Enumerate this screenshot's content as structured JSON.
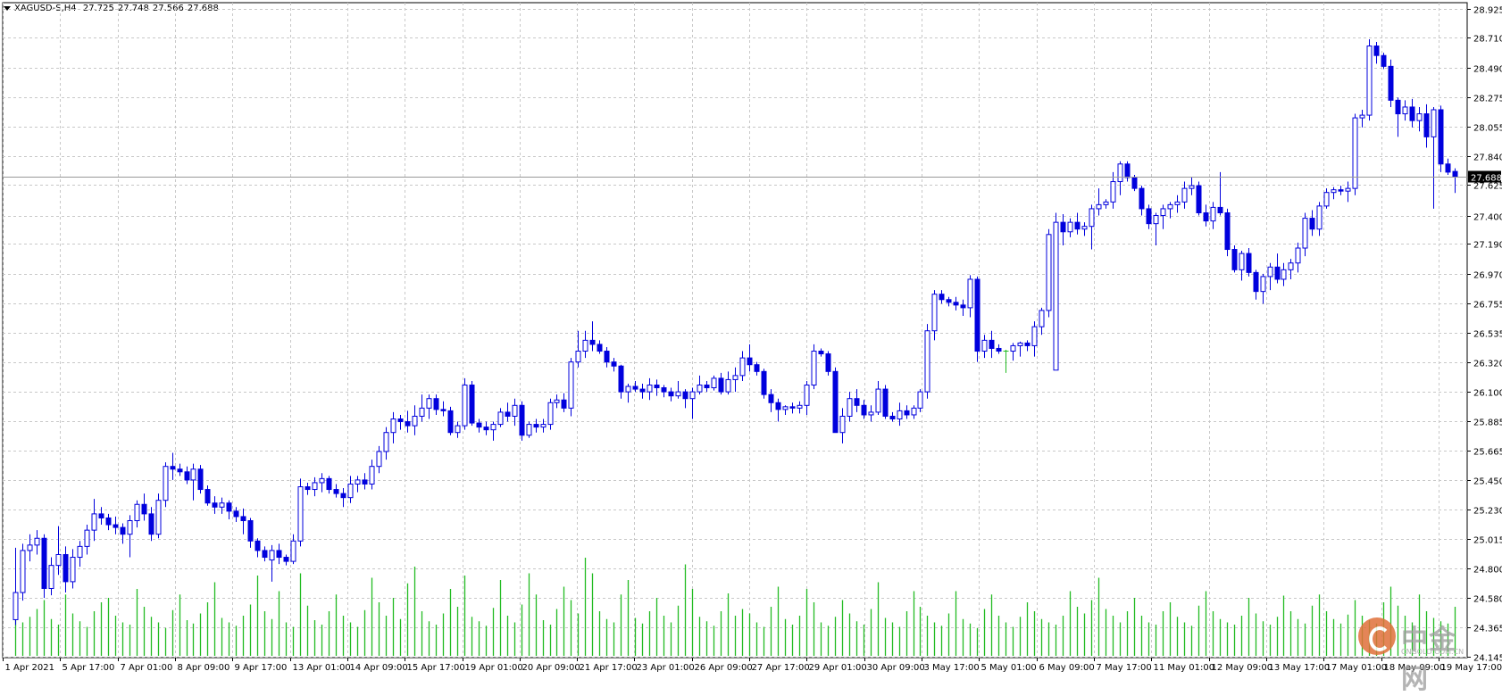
{
  "header": {
    "symbol_tf": "XAGUSD-S,H4",
    "open": "27.725",
    "high": "27.748",
    "low": "27.566",
    "close": "27.688"
  },
  "watermark": {
    "text": "中金网",
    "url": "CNGOLD.COM.CN"
  },
  "colors": {
    "background": "#ffffff",
    "grid": "#c8c8c8",
    "candle": "#0000dd",
    "bull_fill": "#ffffff",
    "bear_fill": "#0000dd",
    "volume": "#22bb22",
    "doji": "#22bb22",
    "price_line": "#999999"
  },
  "chart_data": {
    "type": "candlestick",
    "symbol": "XAGUSD-S",
    "timeframe": "H4",
    "grid": true,
    "ylim": [
      24.14,
      28.93
    ],
    "y_ticks": [
      "28.925",
      "28.710",
      "28.490",
      "28.275",
      "28.055",
      "27.840",
      "27.625",
      "27.400",
      "27.190",
      "26.970",
      "26.755",
      "26.535",
      "26.320",
      "26.100",
      "25.885",
      "25.665",
      "25.450",
      "25.230",
      "25.015",
      "24.800",
      "24.580",
      "24.365",
      "24.145"
    ],
    "last_price": "27.688",
    "x_ticks": [
      "1 Apr 2021",
      "5 Apr 17:00",
      "7 Apr 01:00",
      "8 Apr 09:00",
      "9 Apr 17:00",
      "13 Apr 01:00",
      "14 Apr 09:00",
      "15 Apr 17:00",
      "19 Apr 01:00",
      "20 Apr 09:00",
      "21 Apr 17:00",
      "23 Apr 01:00",
      "26 Apr 09:00",
      "27 Apr 17:00",
      "29 Apr 01:00",
      "30 Apr 09:00",
      "3 May 17:00",
      "5 May 01:00",
      "6 May 09:00",
      "7 May 17:00",
      "11 May 01:00",
      "12 May 09:00",
      "13 May 17:00",
      "17 May 01:00",
      "18 May 09:00",
      "19 May 17:00"
    ],
    "candles": [
      [
        24.42,
        24.95,
        24.38,
        24.62
      ],
      [
        24.62,
        24.98,
        24.56,
        24.93
      ],
      [
        24.93,
        25.05,
        24.85,
        24.97
      ],
      [
        24.97,
        25.08,
        24.9,
        25.02
      ],
      [
        25.02,
        25.05,
        24.58,
        24.65
      ],
      [
        24.65,
        24.88,
        24.6,
        24.82
      ],
      [
        24.82,
        25.11,
        24.75,
        24.9
      ],
      [
        24.9,
        24.96,
        24.62,
        24.7
      ],
      [
        24.7,
        24.94,
        24.65,
        24.88
      ],
      [
        24.88,
        25.0,
        24.81,
        24.96
      ],
      [
        24.96,
        25.12,
        24.9,
        25.08
      ],
      [
        25.08,
        25.31,
        25.0,
        25.2
      ],
      [
        25.2,
        25.25,
        25.12,
        25.17
      ],
      [
        25.17,
        25.2,
        25.08,
        25.12
      ],
      [
        25.12,
        25.18,
        25.05,
        25.1
      ],
      [
        25.1,
        25.13,
        24.98,
        25.05
      ],
      [
        25.05,
        25.19,
        24.88,
        25.15
      ],
      [
        25.15,
        25.3,
        25.1,
        25.27
      ],
      [
        25.27,
        25.35,
        25.15,
        25.2
      ],
      [
        25.2,
        25.25,
        25.0,
        25.05
      ],
      [
        25.05,
        25.35,
        25.02,
        25.3
      ],
      [
        25.3,
        25.58,
        25.25,
        25.55
      ],
      [
        25.55,
        25.65,
        25.45,
        25.53
      ],
      [
        25.53,
        25.57,
        25.48,
        25.51
      ],
      [
        25.51,
        25.55,
        25.42,
        25.45
      ],
      [
        25.45,
        25.57,
        25.3,
        25.53
      ],
      [
        25.53,
        25.56,
        25.35,
        25.38
      ],
      [
        25.38,
        25.41,
        25.26,
        25.28
      ],
      [
        25.28,
        25.33,
        25.2,
        25.25
      ],
      [
        25.25,
        25.32,
        25.2,
        25.28
      ],
      [
        25.28,
        25.3,
        25.16,
        25.22
      ],
      [
        25.22,
        25.25,
        25.14,
        25.18
      ],
      [
        25.18,
        25.24,
        25.05,
        25.15
      ],
      [
        25.15,
        25.17,
        24.95,
        25.0
      ],
      [
        25.0,
        25.02,
        24.88,
        24.93
      ],
      [
        24.93,
        24.96,
        24.85,
        24.88
      ],
      [
        24.86,
        24.97,
        24.7,
        24.93
      ],
      [
        24.93,
        24.98,
        24.83,
        24.88
      ],
      [
        24.88,
        24.9,
        24.82,
        24.85
      ],
      [
        24.85,
        25.05,
        24.83,
        25.0
      ],
      [
        25.0,
        25.46,
        24.96,
        25.4
      ],
      [
        25.4,
        25.43,
        25.34,
        25.38
      ],
      [
        25.38,
        25.47,
        25.33,
        25.43
      ],
      [
        25.43,
        25.5,
        25.36,
        25.46
      ],
      [
        25.46,
        25.48,
        25.35,
        25.38
      ],
      [
        25.38,
        25.42,
        25.32,
        25.35
      ],
      [
        25.35,
        25.39,
        25.25,
        25.32
      ],
      [
        25.32,
        25.48,
        25.28,
        25.42
      ],
      [
        25.42,
        25.48,
        25.36,
        25.45
      ],
      [
        25.45,
        25.5,
        25.38,
        25.42
      ],
      [
        25.42,
        25.6,
        25.38,
        25.55
      ],
      [
        25.55,
        25.7,
        25.5,
        25.66
      ],
      [
        25.66,
        25.84,
        25.6,
        25.8
      ],
      [
        25.8,
        25.95,
        25.72,
        25.9
      ],
      [
        25.9,
        25.93,
        25.82,
        25.88
      ],
      [
        25.88,
        25.96,
        25.8,
        25.85
      ],
      [
        25.85,
        26.0,
        25.78,
        25.92
      ],
      [
        25.92,
        26.08,
        25.88,
        25.98
      ],
      [
        25.98,
        26.08,
        25.9,
        26.05
      ],
      [
        26.05,
        26.08,
        25.93,
        25.97
      ],
      [
        25.97,
        26.03,
        25.92,
        25.96
      ],
      [
        25.96,
        25.99,
        25.78,
        25.8
      ],
      [
        25.8,
        25.88,
        25.76,
        25.85
      ],
      [
        25.85,
        26.2,
        25.82,
        26.15
      ],
      [
        26.15,
        26.18,
        25.85,
        25.87
      ],
      [
        25.87,
        25.9,
        25.8,
        25.84
      ],
      [
        25.84,
        25.88,
        25.78,
        25.82
      ],
      [
        25.82,
        25.88,
        25.74,
        25.86
      ],
      [
        25.86,
        25.98,
        25.84,
        25.95
      ],
      [
        25.95,
        26.02,
        25.88,
        25.92
      ],
      [
        25.92,
        26.05,
        25.85,
        26.0
      ],
      [
        26.0,
        26.03,
        25.74,
        25.78
      ],
      [
        25.78,
        25.88,
        25.76,
        25.86
      ],
      [
        25.86,
        25.9,
        25.8,
        25.84
      ],
      [
        25.84,
        25.9,
        25.8,
        25.86
      ],
      [
        25.86,
        26.05,
        25.82,
        26.02
      ],
      [
        26.02,
        26.08,
        25.98,
        26.04
      ],
      [
        26.04,
        26.09,
        25.95,
        25.98
      ],
      [
        25.98,
        26.35,
        25.92,
        26.32
      ],
      [
        26.32,
        26.55,
        26.28,
        26.4
      ],
      [
        26.4,
        26.55,
        26.35,
        26.48
      ],
      [
        26.48,
        26.62,
        26.4,
        26.45
      ],
      [
        26.45,
        26.48,
        26.38,
        26.4
      ],
      [
        26.4,
        26.43,
        26.28,
        26.32
      ],
      [
        26.32,
        26.35,
        26.25,
        26.29
      ],
      [
        26.29,
        26.3,
        26.05,
        26.1
      ],
      [
        26.1,
        26.16,
        26.02,
        26.14
      ],
      [
        26.14,
        26.18,
        26.1,
        26.12
      ],
      [
        26.12,
        26.16,
        26.05,
        26.1
      ],
      [
        26.1,
        26.2,
        26.04,
        26.15
      ],
      [
        26.15,
        26.19,
        26.07,
        26.13
      ],
      [
        26.13,
        26.15,
        26.06,
        26.1
      ],
      [
        26.1,
        26.13,
        26.03,
        26.07
      ],
      [
        26.07,
        26.18,
        26.05,
        26.1
      ],
      [
        26.1,
        26.12,
        25.98,
        26.05
      ],
      [
        26.05,
        26.13,
        25.9,
        26.1
      ],
      [
        26.1,
        26.22,
        26.08,
        26.15
      ],
      [
        26.15,
        26.18,
        26.1,
        26.13
      ],
      [
        26.13,
        26.22,
        26.11,
        26.2
      ],
      [
        26.2,
        26.24,
        26.08,
        26.1
      ],
      [
        26.1,
        26.25,
        26.08,
        26.19
      ],
      [
        26.19,
        26.28,
        26.1,
        26.22
      ],
      [
        26.22,
        26.4,
        26.18,
        26.35
      ],
      [
        26.35,
        26.45,
        26.25,
        26.3
      ],
      [
        26.3,
        26.32,
        26.22,
        26.25
      ],
      [
        26.25,
        26.27,
        26.05,
        26.08
      ],
      [
        26.08,
        26.12,
        25.95,
        26.02
      ],
      [
        26.02,
        26.05,
        25.88,
        25.97
      ],
      [
        25.97,
        26.0,
        25.93,
        25.99
      ],
      [
        25.99,
        26.02,
        25.94,
        25.98
      ],
      [
        25.98,
        26.03,
        25.94,
        26.0
      ],
      [
        26.0,
        26.18,
        25.93,
        26.15
      ],
      [
        26.15,
        26.45,
        26.12,
        26.4
      ],
      [
        26.4,
        26.42,
        26.36,
        26.38
      ],
      [
        26.38,
        26.4,
        26.22,
        26.25
      ],
      [
        26.25,
        26.28,
        25.8,
        25.8
      ],
      [
        25.8,
        25.98,
        25.72,
        25.92
      ],
      [
        25.92,
        26.1,
        25.88,
        26.05
      ],
      [
        26.05,
        26.12,
        25.95,
        26.0
      ],
      [
        26.0,
        26.04,
        25.9,
        25.93
      ],
      [
        25.93,
        26.0,
        25.88,
        25.95
      ],
      [
        25.95,
        26.18,
        25.93,
        26.12
      ],
      [
        26.12,
        26.15,
        25.9,
        25.92
      ],
      [
        25.92,
        25.95,
        25.88,
        25.9
      ],
      [
        25.9,
        26.02,
        25.85,
        25.96
      ],
      [
        25.96,
        26.0,
        25.9,
        25.93
      ],
      [
        25.93,
        26.0,
        25.9,
        25.98
      ],
      [
        25.98,
        26.12,
        25.95,
        26.1
      ],
      [
        26.1,
        26.6,
        26.05,
        26.55
      ],
      [
        26.55,
        26.85,
        26.48,
        26.82
      ],
      [
        26.82,
        26.85,
        26.75,
        26.78
      ],
      [
        26.78,
        26.8,
        26.73,
        26.76
      ],
      [
        26.76,
        26.8,
        26.7,
        26.74
      ],
      [
        26.74,
        26.78,
        26.66,
        26.72
      ],
      [
        26.72,
        26.96,
        26.65,
        26.93
      ],
      [
        26.93,
        26.95,
        26.32,
        26.4
      ],
      [
        26.4,
        26.52,
        26.35,
        26.48
      ],
      [
        26.48,
        26.55,
        26.35,
        26.42
      ],
      [
        26.42,
        26.45,
        26.38,
        26.4
      ],
      [
        26.4,
        26.41,
        26.24,
        26.4
      ],
      [
        26.4,
        26.46,
        26.33,
        26.44
      ],
      [
        26.44,
        26.47,
        26.36,
        26.46
      ],
      [
        26.46,
        26.48,
        26.4,
        26.44
      ],
      [
        26.44,
        26.62,
        26.36,
        26.58
      ],
      [
        26.58,
        26.72,
        26.52,
        26.7
      ],
      [
        26.7,
        27.3,
        26.65,
        27.26
      ],
      [
        26.26,
        27.42,
        27.18,
        27.35
      ],
      [
        27.35,
        27.41,
        27.18,
        27.28
      ],
      [
        27.28,
        27.38,
        27.24,
        27.35
      ],
      [
        27.35,
        27.42,
        27.26,
        27.3
      ],
      [
        27.3,
        27.35,
        27.25,
        27.32
      ],
      [
        27.32,
        27.48,
        27.15,
        27.45
      ],
      [
        27.45,
        27.6,
        27.4,
        27.48
      ],
      [
        27.48,
        27.52,
        27.45,
        27.5
      ],
      [
        27.5,
        27.72,
        27.45,
        27.65
      ],
      [
        27.65,
        27.8,
        27.55,
        27.78
      ],
      [
        27.78,
        27.8,
        27.65,
        27.68
      ],
      [
        27.68,
        27.7,
        27.58,
        27.6
      ],
      [
        27.6,
        27.62,
        27.4,
        27.45
      ],
      [
        27.45,
        27.48,
        27.3,
        27.34
      ],
      [
        27.34,
        27.42,
        27.18,
        27.4
      ],
      [
        27.4,
        27.48,
        27.3,
        27.45
      ],
      [
        27.45,
        27.5,
        27.38,
        27.48
      ],
      [
        27.48,
        27.55,
        27.42,
        27.5
      ],
      [
        27.5,
        27.65,
        27.45,
        27.6
      ],
      [
        27.6,
        27.68,
        27.55,
        27.62
      ],
      [
        27.62,
        27.65,
        27.4,
        27.42
      ],
      [
        27.42,
        27.48,
        27.32,
        27.36
      ],
      [
        27.36,
        27.5,
        27.3,
        27.46
      ],
      [
        27.46,
        27.72,
        27.4,
        27.42
      ],
      [
        27.42,
        27.45,
        27.1,
        27.15
      ],
      [
        27.15,
        27.18,
        26.98,
        27.0
      ],
      [
        27.0,
        27.14,
        26.92,
        27.12
      ],
      [
        27.12,
        27.16,
        26.95,
        26.98
      ],
      [
        26.98,
        27.0,
        26.78,
        26.84
      ],
      [
        26.84,
        26.97,
        26.75,
        26.95
      ],
      [
        26.95,
        27.05,
        26.85,
        27.02
      ],
      [
        27.02,
        27.12,
        26.9,
        26.93
      ],
      [
        26.93,
        27.05,
        26.88,
        27.0
      ],
      [
        27.0,
        27.08,
        26.93,
        27.05
      ],
      [
        27.05,
        27.2,
        26.98,
        27.16
      ],
      [
        27.16,
        27.42,
        27.1,
        27.38
      ],
      [
        27.38,
        27.44,
        27.25,
        27.3
      ],
      [
        27.3,
        27.5,
        27.25,
        27.47
      ],
      [
        27.47,
        27.6,
        27.45,
        27.57
      ],
      [
        27.57,
        27.61,
        27.52,
        27.59
      ],
      [
        27.59,
        27.62,
        27.55,
        27.58
      ],
      [
        27.58,
        27.65,
        27.5,
        27.6
      ],
      [
        27.6,
        28.15,
        27.55,
        28.12
      ],
      [
        28.12,
        28.18,
        28.05,
        28.14
      ],
      [
        28.14,
        28.7,
        28.1,
        28.65
      ],
      [
        28.65,
        28.68,
        28.52,
        28.58
      ],
      [
        28.58,
        28.6,
        28.48,
        28.5
      ],
      [
        28.5,
        28.55,
        28.2,
        28.25
      ],
      [
        28.25,
        28.27,
        27.98,
        28.15
      ],
      [
        28.15,
        28.25,
        28.1,
        28.2
      ],
      [
        28.2,
        28.26,
        28.05,
        28.1
      ],
      [
        28.1,
        28.2,
        28.02,
        28.15
      ],
      [
        28.15,
        28.22,
        27.9,
        27.98
      ],
      [
        27.98,
        28.2,
        27.45,
        28.18
      ],
      [
        28.18,
        28.21,
        27.72,
        27.78
      ],
      [
        27.78,
        27.82,
        27.7,
        27.72
      ],
      [
        27.725,
        27.748,
        27.566,
        27.688
      ]
    ],
    "volumes": [
      0.45,
      0.3,
      0.35,
      0.42,
      0.5,
      0.33,
      0.28,
      0.55,
      0.38,
      0.31,
      0.26,
      0.4,
      0.48,
      0.52,
      0.36,
      0.3,
      0.28,
      0.6,
      0.44,
      0.35,
      0.3,
      0.25,
      0.41,
      0.55,
      0.32,
      0.29,
      0.38,
      0.48,
      0.66,
      0.34,
      0.3,
      0.27,
      0.36,
      0.46,
      0.72,
      0.4,
      0.33,
      0.58,
      0.3,
      0.26,
      0.74,
      0.45,
      0.32,
      0.28,
      0.4,
      0.55,
      0.36,
      0.3,
      0.26,
      0.41,
      0.7,
      0.48,
      0.36,
      0.52,
      0.33,
      0.65,
      0.8,
      0.4,
      0.31,
      0.28,
      0.38,
      0.6,
      0.44,
      0.72,
      0.35,
      0.31,
      0.27,
      0.43,
      0.68,
      0.36,
      0.3,
      0.46,
      0.74,
      0.55,
      0.32,
      0.28,
      0.42,
      0.62,
      0.5,
      0.38,
      0.88,
      0.74,
      0.4,
      0.33,
      0.3,
      0.55,
      0.68,
      0.34,
      0.29,
      0.4,
      0.52,
      0.36,
      0.3,
      0.45,
      0.82,
      0.6,
      0.35,
      0.31,
      0.27,
      0.4,
      0.56,
      0.36,
      0.42,
      0.38,
      0.3,
      0.26,
      0.44,
      0.62,
      0.33,
      0.28,
      0.36,
      0.6,
      0.48,
      0.3,
      0.27,
      0.35,
      0.5,
      0.38,
      0.31,
      0.28,
      0.42,
      0.66,
      0.34,
      0.3,
      0.26,
      0.4,
      0.58,
      0.44,
      0.36,
      0.3,
      0.27,
      0.38,
      0.58,
      0.33,
      0.29,
      0.25,
      0.42,
      0.55,
      0.36,
      0.3,
      0.26,
      0.35,
      0.48,
      0.4,
      0.33,
      0.3,
      0.28,
      0.36,
      0.58,
      0.44,
      0.38,
      0.5,
      0.7,
      0.42,
      0.36,
      0.3,
      0.4,
      0.52,
      0.36,
      0.3,
      0.28,
      0.4,
      0.48,
      0.35,
      0.3,
      0.27,
      0.45,
      0.58,
      0.4,
      0.33,
      0.3,
      0.28,
      0.36,
      0.52,
      0.38,
      0.31,
      0.28,
      0.35,
      0.54,
      0.4,
      0.33,
      0.29,
      0.45,
      0.55,
      0.4,
      0.33,
      0.29,
      0.37,
      0.5,
      0.36,
      0.32,
      0.29,
      0.48,
      0.62,
      0.45,
      0.36,
      0.3,
      0.55,
      0.4,
      0.34,
      0.31,
      0.29,
      0.44,
      0.66,
      0.4,
      0.35,
      0.3,
      0.28,
      0.46,
      0.4,
      0.34
    ]
  }
}
